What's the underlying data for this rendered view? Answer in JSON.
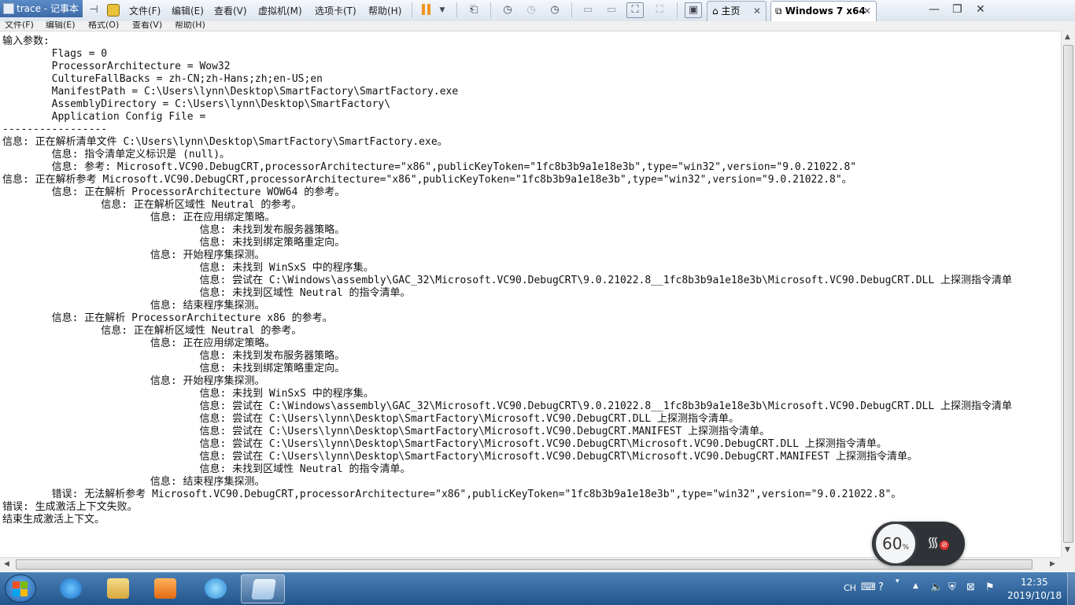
{
  "notepad": {
    "title": "trace - 记事本",
    "menu": [
      "文件(F)",
      "编辑(E)",
      "格式(O)",
      "查看(V)",
      "帮助(H)"
    ]
  },
  "vmware": {
    "menu": [
      "文件(F)",
      "编辑(E)",
      "查看(V)",
      "虚拟机(M)",
      "选项卡(T)",
      "帮助(H)"
    ],
    "tabs": [
      {
        "label": "主页",
        "icon": "home-icon"
      },
      {
        "label": "Windows 7 x64",
        "icon": "vm-icon"
      }
    ]
  },
  "content": {
    "lines": [
      "输入参数:",
      "        Flags = 0",
      "        ProcessorArchitecture = Wow32",
      "        CultureFallBacks = zh-CN;zh-Hans;zh;en-US;en",
      "        ManifestPath = C:\\Users\\lynn\\Desktop\\SmartFactory\\SmartFactory.exe",
      "        AssemblyDirectory = C:\\Users\\lynn\\Desktop\\SmartFactory\\",
      "        Application Config File =",
      "-----------------",
      "信息: 正在解析清单文件 C:\\Users\\lynn\\Desktop\\SmartFactory\\SmartFactory.exe。",
      "        信息: 指令清单定义标识是 (null)。",
      "        信息: 参考: Microsoft.VC90.DebugCRT,processorArchitecture=\"x86\",publicKeyToken=\"1fc8b3b9a1e18e3b\",type=\"win32\",version=\"9.0.21022.8\"",
      "信息: 正在解析参考 Microsoft.VC90.DebugCRT,processorArchitecture=\"x86\",publicKeyToken=\"1fc8b3b9a1e18e3b\",type=\"win32\",version=\"9.0.21022.8\"。",
      "        信息: 正在解析 ProcessorArchitecture WOW64 的参考。",
      "                信息: 正在解析区域性 Neutral 的参考。",
      "                        信息: 正在应用绑定策略。",
      "                                信息: 未找到发布服务器策略。",
      "                                信息: 未找到绑定策略重定向。",
      "                        信息: 开始程序集探测。",
      "                                信息: 未找到 WinSxS 中的程序集。",
      "                                信息: 尝试在 C:\\Windows\\assembly\\GAC_32\\Microsoft.VC90.DebugCRT\\9.0.21022.8__1fc8b3b9a1e18e3b\\Microsoft.VC90.DebugCRT.DLL 上探测指令清单",
      "                                信息: 未找到区域性 Neutral 的指令清单。",
      "                        信息: 结束程序集探测。",
      "        信息: 正在解析 ProcessorArchitecture x86 的参考。",
      "                信息: 正在解析区域性 Neutral 的参考。",
      "                        信息: 正在应用绑定策略。",
      "                                信息: 未找到发布服务器策略。",
      "                                信息: 未找到绑定策略重定向。",
      "                        信息: 开始程序集探测。",
      "                                信息: 未找到 WinSxS 中的程序集。",
      "                                信息: 尝试在 C:\\Windows\\assembly\\GAC_32\\Microsoft.VC90.DebugCRT\\9.0.21022.8__1fc8b3b9a1e18e3b\\Microsoft.VC90.DebugCRT.DLL 上探测指令清单",
      "                                信息: 尝试在 C:\\Users\\lynn\\Desktop\\SmartFactory\\Microsoft.VC90.DebugCRT.DLL 上探测指令清单。",
      "                                信息: 尝试在 C:\\Users\\lynn\\Desktop\\SmartFactory\\Microsoft.VC90.DebugCRT.MANIFEST 上探测指令清单。",
      "                                信息: 尝试在 C:\\Users\\lynn\\Desktop\\SmartFactory\\Microsoft.VC90.DebugCRT\\Microsoft.VC90.DebugCRT.DLL 上探测指令清单。",
      "                                信息: 尝试在 C:\\Users\\lynn\\Desktop\\SmartFactory\\Microsoft.VC90.DebugCRT\\Microsoft.VC90.DebugCRT.MANIFEST 上探测指令清单。",
      "                                信息: 未找到区域性 Neutral 的指令清单。",
      "                        信息: 结束程序集探测。",
      "        错误: 无法解析参考 Microsoft.VC90.DebugCRT,processorArchitecture=\"x86\",publicKeyToken=\"1fc8b3b9a1e18e3b\",type=\"win32\",version=\"9.0.21022.8\"。",
      "错误: 生成激活上下文失败。",
      "结束生成激活上下文。"
    ]
  },
  "widget": {
    "percent": "60",
    "unit": "%"
  },
  "taskbar": {
    "apps": [
      "ie-icon",
      "explorer-icon",
      "media-player-icon",
      "browser-icon",
      "notepad-icon"
    ],
    "language": "CH",
    "time": "12:35",
    "date": "2019/10/18"
  }
}
